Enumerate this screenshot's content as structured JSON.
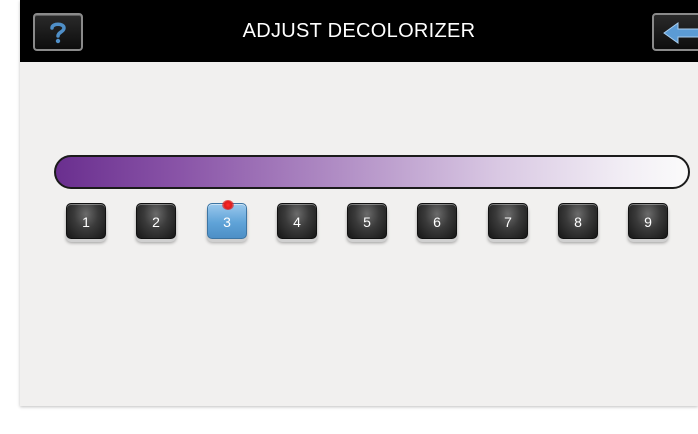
{
  "header": {
    "title": "ADJUST DECOLORIZER",
    "help_icon": "question-mark-icon",
    "back_icon": "back-arrow-icon"
  },
  "colors": {
    "header_bg": "#000000",
    "screen_bg": "#f1f0ef",
    "gradient_start": "#6a2f8f",
    "gradient_end": "#fbfbfb",
    "selected_button": "#5fa3d8",
    "indicator": "#e01a1a"
  },
  "levels": {
    "selected": "3",
    "items": [
      "1",
      "2",
      "3",
      "4",
      "5",
      "6",
      "7",
      "8",
      "9"
    ]
  }
}
